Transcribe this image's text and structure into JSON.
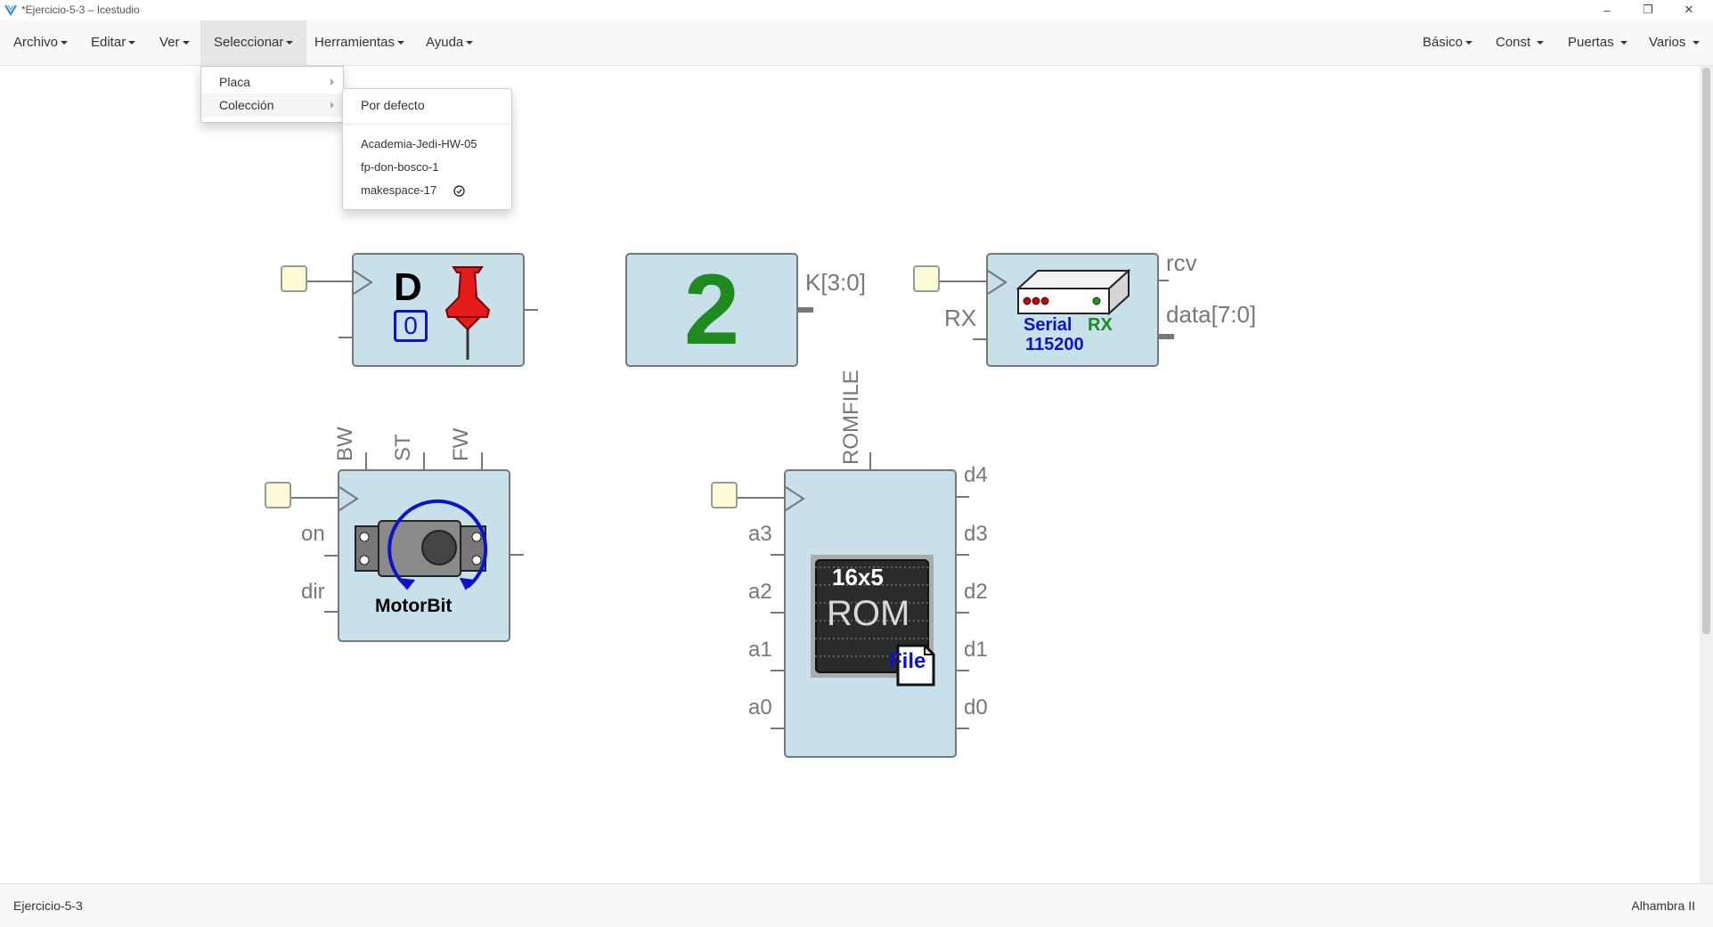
{
  "window": {
    "title": "*Ejercicio-5-3 – Icestudio",
    "minimize": "–",
    "restore": "❐",
    "close": "✕"
  },
  "menubar": {
    "left": [
      "Archivo",
      "Editar",
      "Ver",
      "Seleccionar",
      "Herramientas",
      "Ayuda"
    ],
    "right": [
      "Básico",
      "Const",
      "Puertas",
      "Varios"
    ]
  },
  "seleccionar_menu": {
    "items": [
      "Placa",
      "Colección"
    ]
  },
  "coleccion_submenu": {
    "default": "Por defecto",
    "collections": [
      "Academia-Jedi-HW-05",
      "fp-don-bosco-1",
      "makespace-17"
    ],
    "selected": "makespace-17"
  },
  "blocks": {
    "dff": {
      "title": "D",
      "value": "0"
    },
    "constant": {
      "value": "2",
      "output_label": "K[3:0]"
    },
    "serial_rx": {
      "text1": "Serial",
      "text2": "RX",
      "baud": "115200",
      "input_label": "RX",
      "out_rcv": "rcv",
      "out_data": "data[7:0]"
    },
    "motorbit": {
      "name": "MotorBit",
      "inputs": [
        "on",
        "dir"
      ],
      "top_outputs": [
        "BW",
        "ST",
        "FW"
      ]
    },
    "rom": {
      "size": "16x5",
      "type": "ROM",
      "file": "File",
      "param": "ROMFILE",
      "addr_inputs": [
        "a3",
        "a2",
        "a1",
        "a0"
      ],
      "data_outputs": [
        "d4",
        "d3",
        "d2",
        "d1",
        "d0"
      ]
    }
  },
  "statusbar": {
    "project": "Ejercicio-5-3",
    "board": "Alhambra II"
  },
  "colors": {
    "block_fill": "#c7e0ea",
    "input_pin": "#fcfbd6",
    "constant_green": "#1f8a1f",
    "accent_blue": "#0b14c8"
  }
}
